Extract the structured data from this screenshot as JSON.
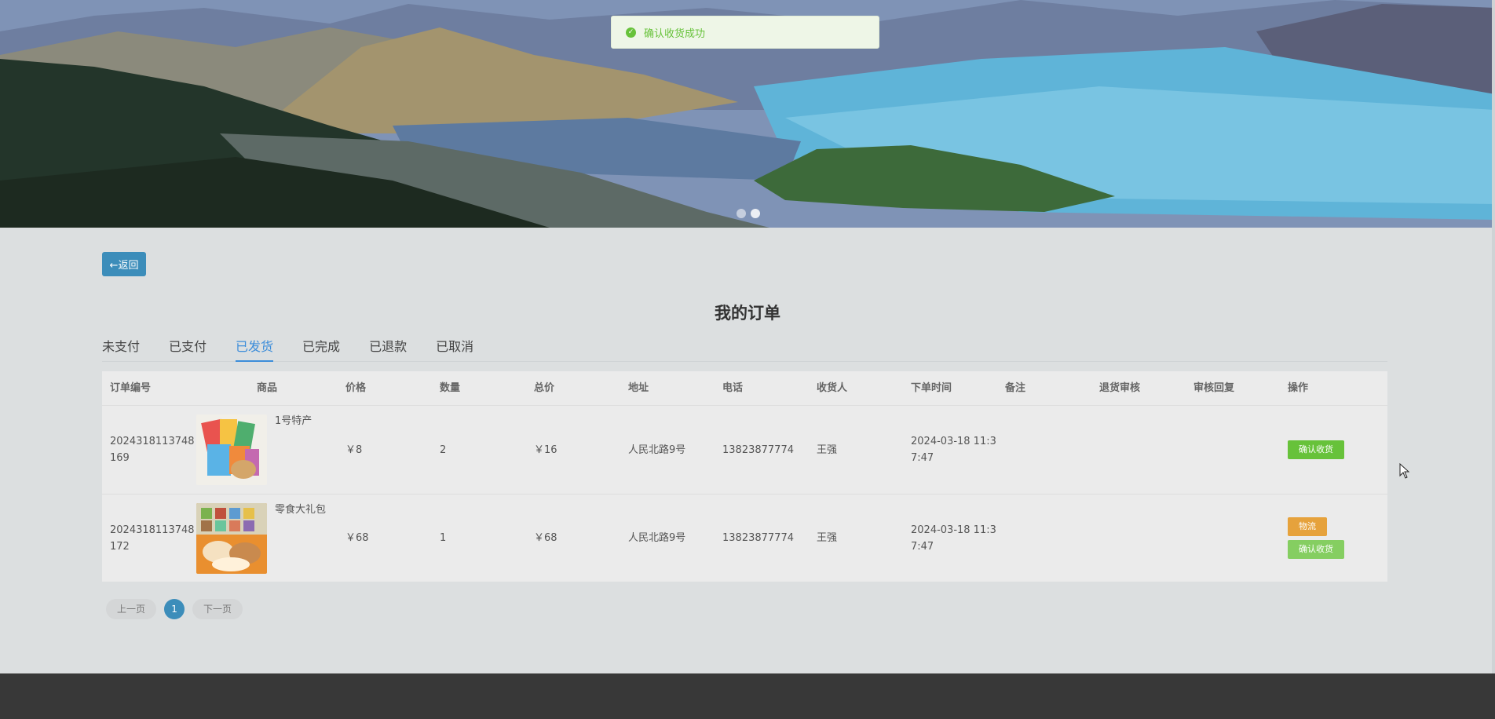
{
  "toast": {
    "message": "确认收货成功",
    "icon": "check-circle-icon",
    "color": "#67c23a"
  },
  "back_button": {
    "label": "←返回"
  },
  "page_title": "我的订单",
  "tabs": [
    {
      "label": "未支付",
      "active": false
    },
    {
      "label": "已支付",
      "active": false
    },
    {
      "label": "已发货",
      "active": true
    },
    {
      "label": "已完成",
      "active": false
    },
    {
      "label": "已退款",
      "active": false
    },
    {
      "label": "已取消",
      "active": false
    }
  ],
  "table": {
    "headers": [
      "订单编号",
      "商品",
      "价格",
      "数量",
      "总价",
      "地址",
      "电话",
      "收货人",
      "下单时间",
      "备注",
      "退货审核",
      "审核回复",
      "操作"
    ],
    "rows": [
      {
        "order_id": "2024318113748169",
        "goods_name": "1号特产",
        "price": "￥8",
        "qty": "2",
        "total": "￥16",
        "address": "人民北路9号",
        "phone": "13823877774",
        "receiver": "王强",
        "order_time": "2024-03-18 11:37:47",
        "note": "",
        "refund_review": "",
        "review_reply": "",
        "actions": {
          "confirm": "确认收货"
        }
      },
      {
        "order_id": "2024318113748172",
        "goods_name": "零食大礼包",
        "price": "￥68",
        "qty": "1",
        "total": "￥68",
        "address": "人民北路9号",
        "phone": "13823877774",
        "receiver": "王强",
        "order_time": "2024-03-18 11:37:47",
        "note": "",
        "refund_review": "",
        "review_reply": "",
        "actions": {
          "logistics": "物流",
          "confirm": "确认收货"
        }
      }
    ]
  },
  "pagination": {
    "prev": "上一页",
    "current": "1",
    "next": "下一页"
  },
  "colors": {
    "accent": "#3c8dba",
    "success": "#67c23a",
    "warning": "#e6a23c",
    "footer": "#383838"
  }
}
